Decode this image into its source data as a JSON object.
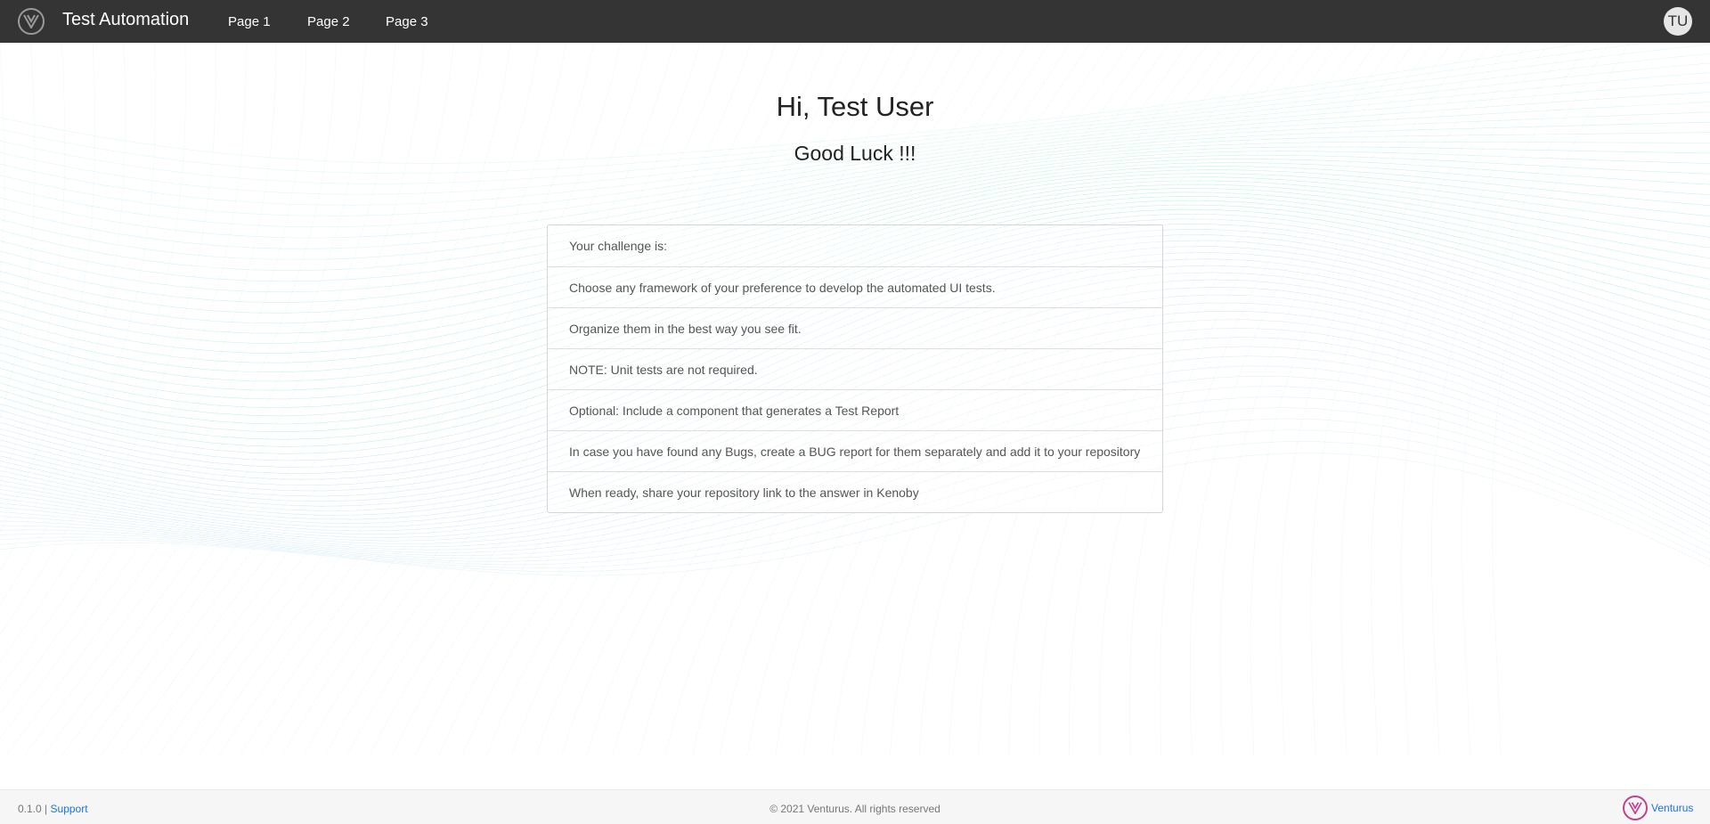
{
  "header": {
    "brand_title": "Test Automation",
    "nav": [
      {
        "label": "Page 1"
      },
      {
        "label": "Page 2"
      },
      {
        "label": "Page 3"
      }
    ],
    "avatar_initials": "TU",
    "logo_icon": "venturus-v-icon"
  },
  "main": {
    "greeting": "Hi, Test User",
    "subgreeting": "Good Luck !!!",
    "challenge_items": [
      "Your challenge is:",
      "Choose any framework of your preference to develop the automated UI tests.",
      "Organize them in the best way you see fit.",
      "NOTE: Unit tests are not required.",
      "Optional: Include a component that generates a Test Report",
      "In case you have found any Bugs, create a BUG report for them separately and add it to your repository",
      "When ready, share your repository link to the answer in Kenoby"
    ]
  },
  "footer": {
    "version": "0.1.0",
    "separator": "|",
    "support_label": "Support",
    "copyright": "© 2021 Venturus. All rights reserved",
    "company_link": "Venturus"
  },
  "colors": {
    "navbar": "#343434",
    "wave_green": "#5fe0b0",
    "wave_blue": "#8fc9e8",
    "link": "#1a73e8",
    "brand_magenta": "#c2418d"
  }
}
